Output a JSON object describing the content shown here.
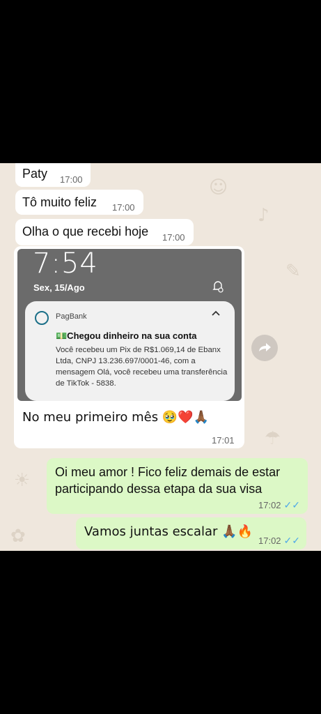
{
  "messages": [
    {
      "text": "Paty",
      "time": "17:00"
    },
    {
      "text": "Tô muito feliz",
      "time": "17:00"
    },
    {
      "text": "Olha o que recebi hoje",
      "time": "17:00"
    },
    {
      "caption": "No meu primeiro mês 🥹❤️🙏🏾",
      "time": "17:01"
    },
    {
      "text": "Oi meu amor ! Fico feliz demais de estar participando dessa etapa da sua visa",
      "time": "17:02"
    },
    {
      "text": "Vamos juntas escalar 🙏🏾🔥",
      "time": "17:02"
    }
  ],
  "screenshot": {
    "clock": "7:54",
    "date": "Sex, 15/Ago",
    "notification": {
      "app": "PagBank",
      "title": "💵Chegou dinheiro na sua conta",
      "body": "Você recebeu um Pix de R$1.069,14 de Ebanx Ltda, CNPJ 13.236.697/0001-46, com a mensagem Olá, você recebeu uma transferência de TikTok - 5838."
    }
  },
  "icons": {
    "forward": "forward-icon",
    "read_receipt": "double-check-icon",
    "expand": "chevron-up-icon",
    "alarm": "alarm-bell-icon"
  },
  "colors": {
    "incoming": "#ffffff",
    "outgoing": "#dcf8c6",
    "tick": "#4fa9e8",
    "chat_bg": "#efe7dd"
  }
}
